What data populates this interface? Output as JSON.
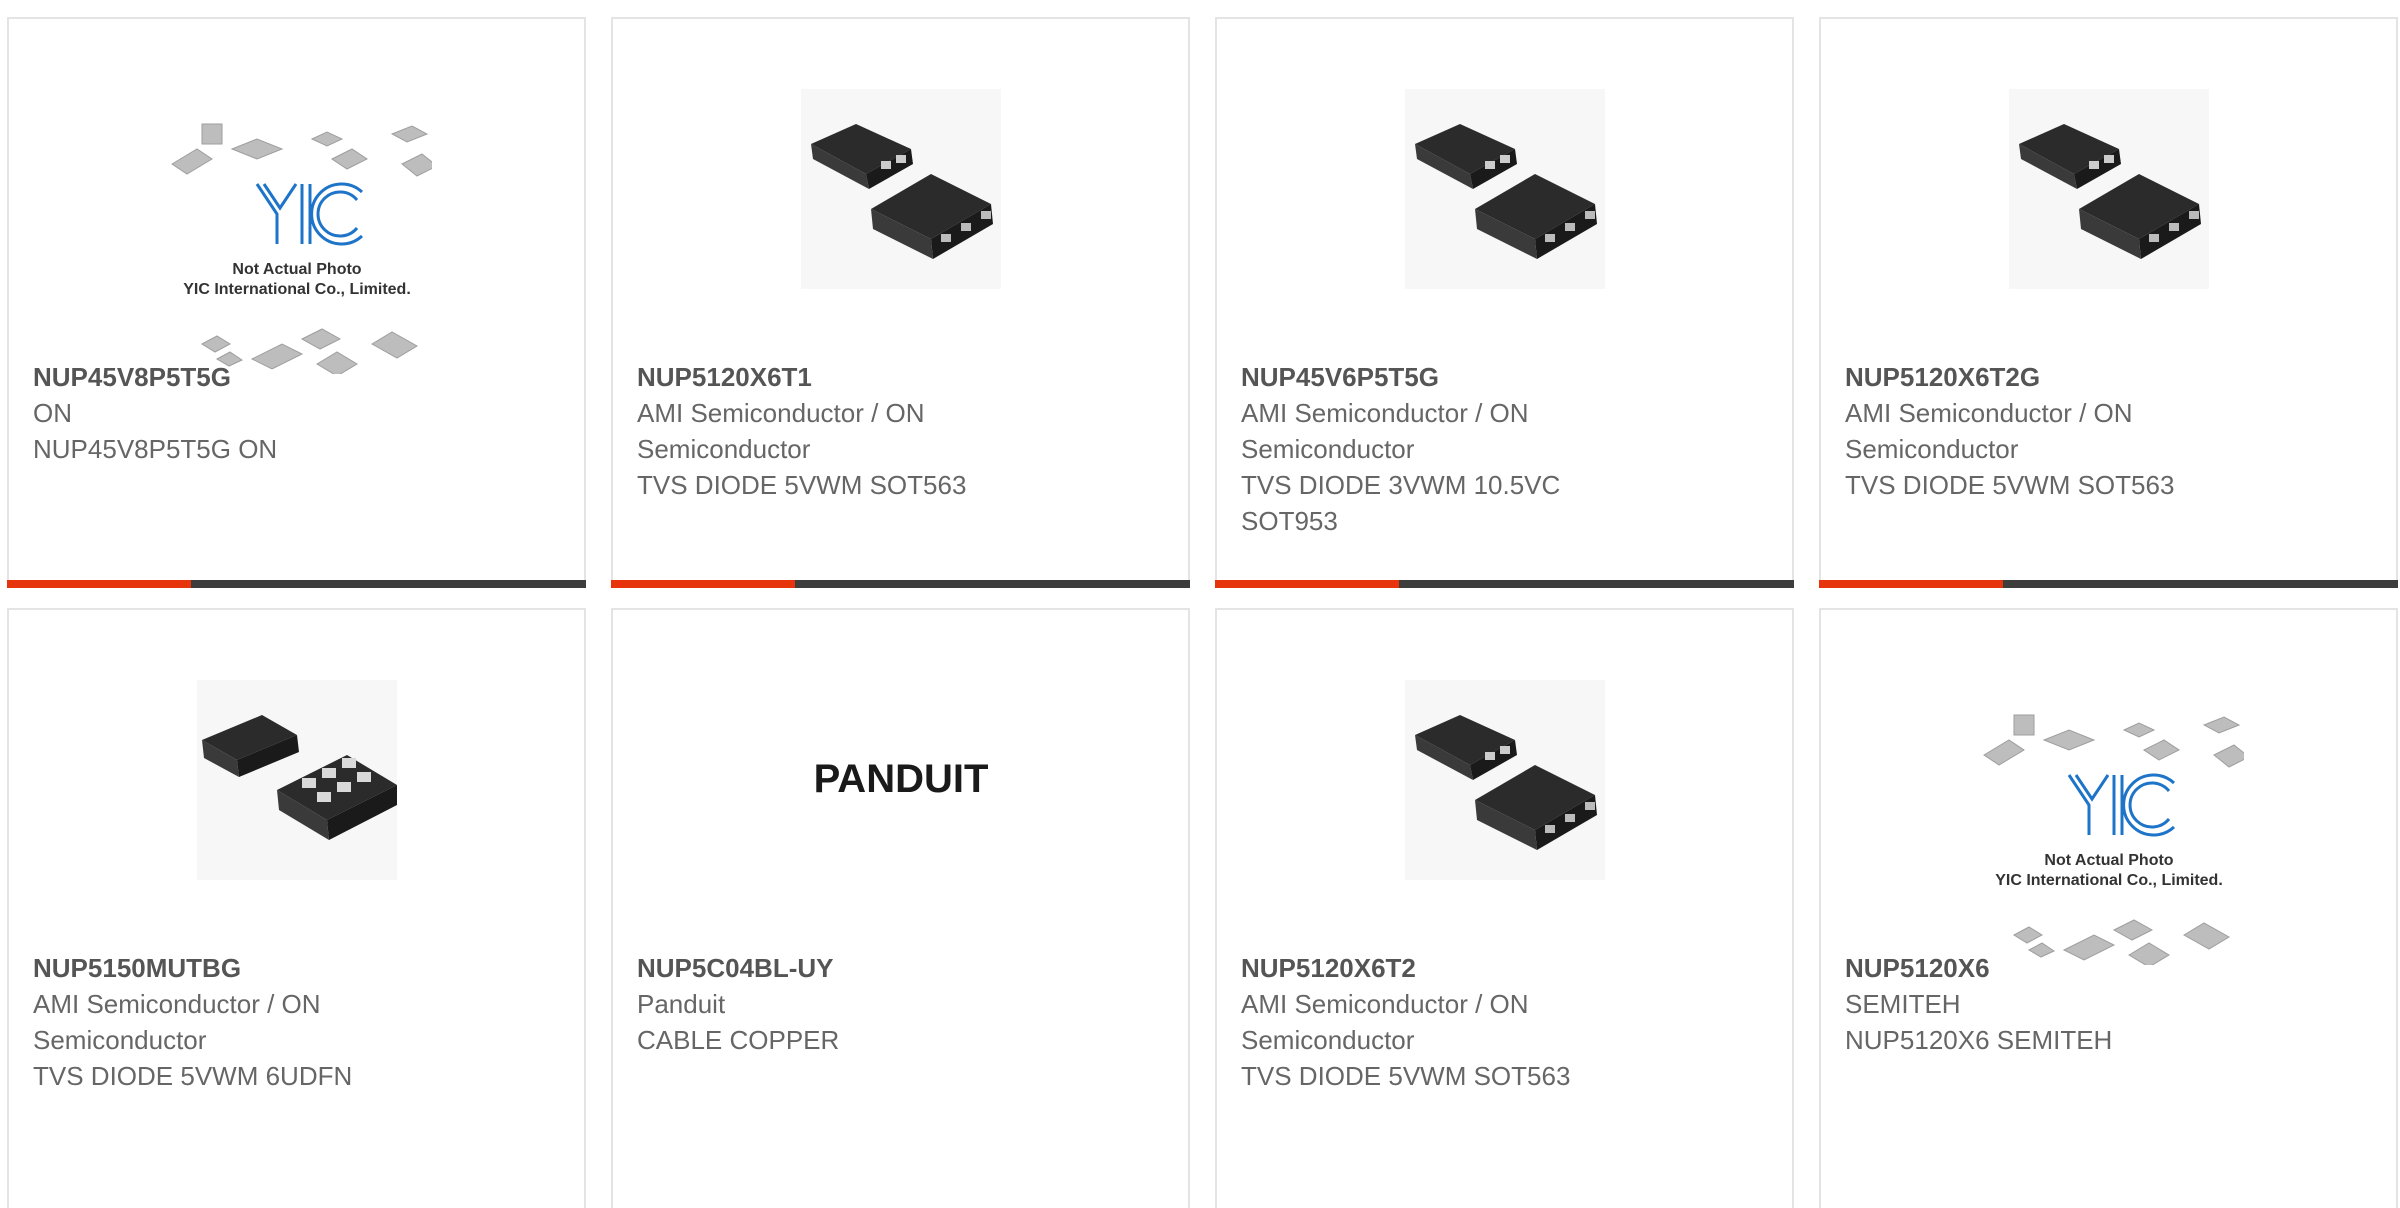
{
  "products": [
    {
      "part_number": "NUP45V8P5T5G",
      "manufacturer": "ON",
      "description": "NUP45V8P5T5G ON",
      "image": "placeholder-photo"
    },
    {
      "part_number": "NUP5120X6T1",
      "manufacturer": "AMI Semiconductor / ON Semiconductor",
      "description": "TVS DIODE 5VWM SOT563",
      "image": "sot563-package"
    },
    {
      "part_number": "NUP45V6P5T5G",
      "manufacturer": "AMI Semiconductor / ON Semiconductor",
      "description": "TVS DIODE 3VWM 10.5VC SOT953",
      "image": "sot563-package"
    },
    {
      "part_number": "NUP5120X6T2G",
      "manufacturer": "AMI Semiconductor / ON Semiconductor",
      "description": "TVS DIODE 5VWM SOT563",
      "image": "sot563-package"
    },
    {
      "part_number": "NUP5150MUTBG",
      "manufacturer": "AMI Semiconductor / ON Semiconductor",
      "description": "TVS DIODE 5VWM 6UDFN",
      "image": "udfn-package"
    },
    {
      "part_number": "NUP5C04BL-UY",
      "manufacturer": "Panduit",
      "description": "CABLE COPPER",
      "image": "panduit-logo"
    },
    {
      "part_number": "NUP5120X6T2",
      "manufacturer": "AMI Semiconductor / ON Semiconductor",
      "description": "TVS DIODE 5VWM SOT563",
      "image": "sot563-package"
    },
    {
      "part_number": "NUP5120X6",
      "manufacturer": "SEMITEH",
      "description": "NUP5120X6 SEMITEH",
      "image": "placeholder-photo"
    }
  ],
  "placeholder": {
    "logo_text": "YIC",
    "line1": "Not Actual Photo",
    "line2": "YIC International Co., Limited."
  },
  "panduit_logo_text": "PANDUIT",
  "colors": {
    "accent": "#e8340c",
    "bar": "#3d3d3d",
    "border": "#e4e4e4",
    "part_number": "#555555",
    "text": "#666666"
  }
}
